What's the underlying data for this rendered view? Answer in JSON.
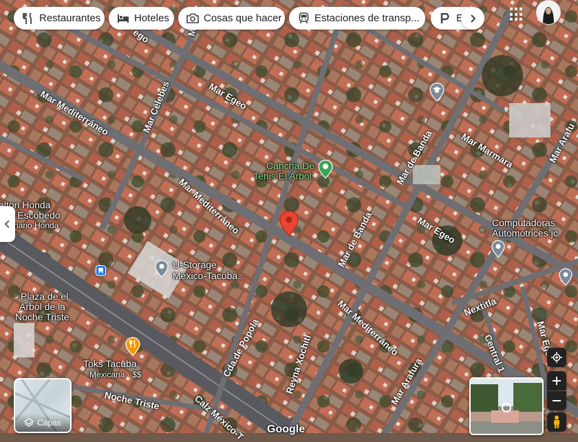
{
  "categories": [
    {
      "label": "Restaurantes",
      "icon": "restaurant-icon"
    },
    {
      "label": "Hoteles",
      "icon": "hotel-icon"
    },
    {
      "label": "Cosas que hacer",
      "icon": "camera-icon"
    },
    {
      "label": "Estaciones de transp...",
      "icon": "train-icon"
    },
    {
      "label": "Es",
      "icon": "parking-icon"
    }
  ],
  "streets": {
    "mar_mediterraneo_1": "Mar Mediterráneo",
    "mar_mediterraneo_2": "Mar Mediterráneo",
    "mar_mediterraneo_3": "Mar Mediterráneo",
    "mar_celebes": "Mar Célebes",
    "mar_egeo_1": "Mar Egeo",
    "mar_egeo_2": "Mar Egeo",
    "mar_egeo_top": "ego",
    "mar_egeo_3": "Mar Ege",
    "mar_de_banda_1": "Mar de Banda",
    "mar_de_banda_2": "Mar de Banda",
    "mar_marmara": "Mar Marmara",
    "mar_arafura_1": "Mar Arafura",
    "mar_arafura_2": "Mar Arafu",
    "nextitla": "Nextitla",
    "central_1": "Central 1",
    "reyna_xochitl": "Reyna Xochitl",
    "cda_popola": "Cda.de Popola",
    "noche_triste": "Noche Triste",
    "calz_mexico": "Calz México-T",
    "top_ma": "Ma",
    "bottom": "Google"
  },
  "places": {
    "cancha": {
      "line1": "Cancha De",
      "line2": "Tenis El Arbol"
    },
    "ustorage": {
      "line1": "U-Storage",
      "line2": "México-Tacuba..."
    },
    "computadoras": {
      "line1": "Computadoras",
      "line2": "Automotrices jc"
    },
    "toks": {
      "line1": "Toks Tacuba",
      "sub": "Mexicana · $$"
    },
    "plaza": {
      "line1": "Plaza de el",
      "line2": "Arbol de la",
      "line3": "Noche Triste"
    },
    "dalton": {
      "line1": "alton Honda",
      "line2": "ano Escobedo",
      "line3": "esionario Honda"
    }
  },
  "controls": {
    "layers_label": "Capas"
  },
  "colors": {
    "pin_red": "#ea4335",
    "park_green": "#34a853",
    "poi_gray": "#7b8a99",
    "food_orange": "#f29900",
    "transit_blue": "#1a73e8"
  }
}
